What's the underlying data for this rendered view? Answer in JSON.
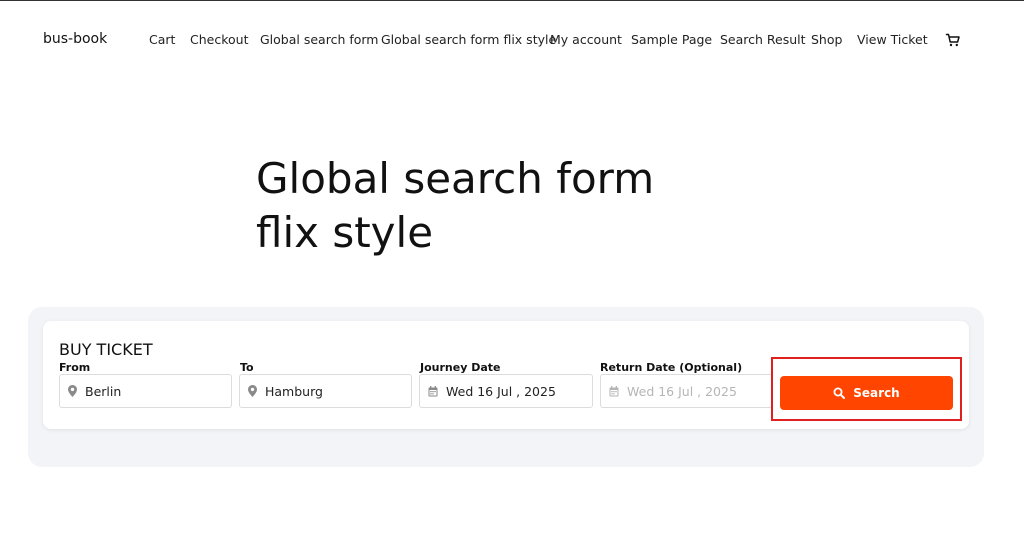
{
  "site": {
    "title": "bus-book"
  },
  "nav": {
    "items": [
      "Cart",
      "Checkout",
      "Global search form",
      "Global search form flix style",
      "My account",
      "Sample Page",
      "Search Result",
      "Shop",
      "View Ticket"
    ]
  },
  "page": {
    "title": "Global search form flix style"
  },
  "form": {
    "heading": "BUY TICKET",
    "from": {
      "label": "From",
      "value": "Berlin"
    },
    "to": {
      "label": "To",
      "value": "Hamburg"
    },
    "journey_date": {
      "label": "Journey Date",
      "value": "Wed 16 Jul , 2025"
    },
    "return_date": {
      "label": "Return Date (Optional)",
      "placeholder": "Wed 16 Jul , 2025"
    },
    "search_label": "Search"
  },
  "colors": {
    "accent": "#ff4500",
    "highlight": "#e01f1f",
    "panel": "#f3f4f8"
  }
}
